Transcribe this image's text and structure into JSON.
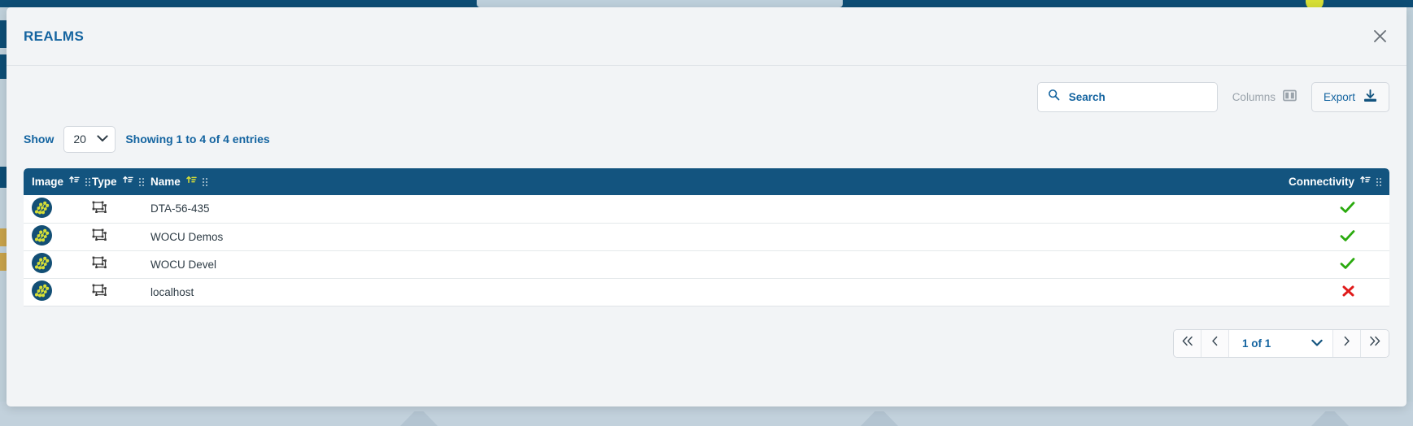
{
  "modal": {
    "title": "REALMS",
    "close_icon": "close-icon"
  },
  "toolbar": {
    "search_placeholder": "Search",
    "search_value": "",
    "search_icon": "search-icon",
    "columns_label": "Columns",
    "columns_icon": "columns-icon",
    "export_label": "Export",
    "export_icon": "download-icon"
  },
  "entries": {
    "show_label": "Show",
    "page_size": "20",
    "page_size_options": [
      "20"
    ],
    "showing_text": "Showing 1 to 4 of 4 entries",
    "showing_prefix": "Showing ",
    "showing_from": "1",
    "showing_mid": " to ",
    "showing_to": "4",
    "showing_mid2": " of ",
    "showing_total": "4",
    "showing_suffix": " entries"
  },
  "table": {
    "columns": [
      {
        "label": "Image",
        "sort_icon": "sort-icon",
        "sort_active": false,
        "grip_icon": "drag-handle-icon"
      },
      {
        "label": "Type",
        "sort_icon": "sort-icon",
        "sort_active": false,
        "grip_icon": "drag-handle-icon"
      },
      {
        "label": "Name",
        "sort_icon": "sort-icon",
        "sort_active": true,
        "grip_icon": "drag-handle-icon"
      },
      {
        "label": "Connectivity",
        "sort_icon": "sort-icon",
        "sort_active": false,
        "grip_icon": "drag-handle-icon"
      }
    ],
    "rows": [
      {
        "image_icon": "realm-avatar-icon",
        "type_icon": "hosts-icon",
        "name": "DTA-56-435",
        "connectivity": "ok",
        "connectivity_icon": "check-icon"
      },
      {
        "image_icon": "realm-avatar-icon",
        "type_icon": "hosts-icon",
        "name": "WOCU Demos",
        "connectivity": "ok",
        "connectivity_icon": "check-icon"
      },
      {
        "image_icon": "realm-avatar-icon",
        "type_icon": "hosts-icon",
        "name": "WOCU Devel",
        "connectivity": "ok",
        "connectivity_icon": "check-icon"
      },
      {
        "image_icon": "realm-avatar-icon",
        "type_icon": "hosts-icon",
        "name": "localhost",
        "connectivity": "fail",
        "connectivity_icon": "cross-icon"
      }
    ]
  },
  "pagination": {
    "first_icon": "double-chevron-left-icon",
    "prev_icon": "chevron-left-icon",
    "page_label": "1 of 1",
    "page_options": [
      "1 of 1"
    ],
    "dropdown_icon": "chevron-down-icon",
    "next_icon": "chevron-right-icon",
    "last_icon": "double-chevron-right-icon"
  },
  "colors": {
    "brand_blue": "#1464a0",
    "header_blue": "#13547f",
    "accent_yellow": "#d7df36",
    "success_green": "#2aaa0e",
    "error_red": "#e01b1b",
    "modal_bg": "#f2f4f6"
  }
}
